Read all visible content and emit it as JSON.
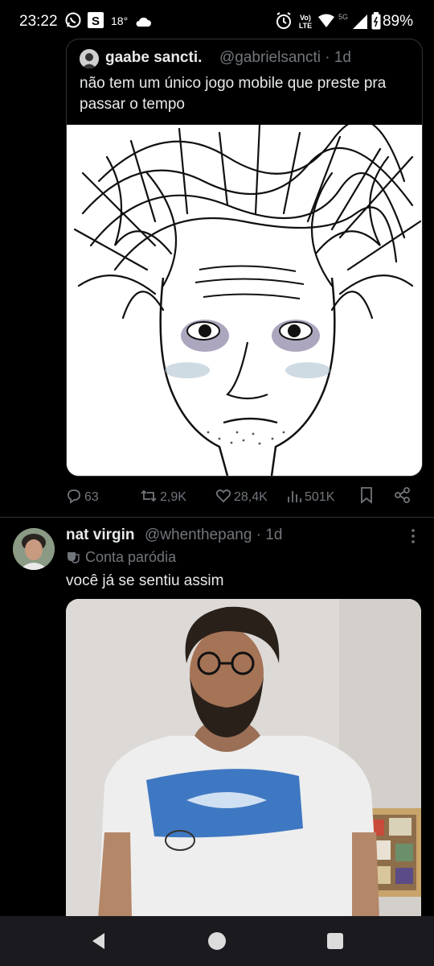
{
  "status": {
    "time": "23:22",
    "temperature": "18°",
    "network": "5G",
    "battery": "89%",
    "icons": [
      "whatsapp-icon",
      "s-app-icon",
      "cloud-icon",
      "alarm-icon",
      "volte-icon",
      "wifi-icon",
      "signal-icon",
      "battery-icon"
    ]
  },
  "quoted_tweet": {
    "author_name": "gaabe sancti.",
    "author_handle": "@gabrielsancti · 1d",
    "text": "não tem um único jogo mobile que preste pra passar o tempo",
    "media": "drawn-face-meme"
  },
  "actions": {
    "replies": "63",
    "retweets": "2,9K",
    "likes": "28,4K",
    "views": "501K"
  },
  "tweet": {
    "author_name": "nat virgin",
    "author_handle": "@whenthepang · 1d",
    "parody_label": "Conta paródia",
    "text": "você já se sentiu assim",
    "media": "photo-man-tshirt"
  },
  "colors": {
    "background": "#000000",
    "text": "#e7e9ea",
    "muted": "#71767b",
    "border": "#2f3336"
  }
}
